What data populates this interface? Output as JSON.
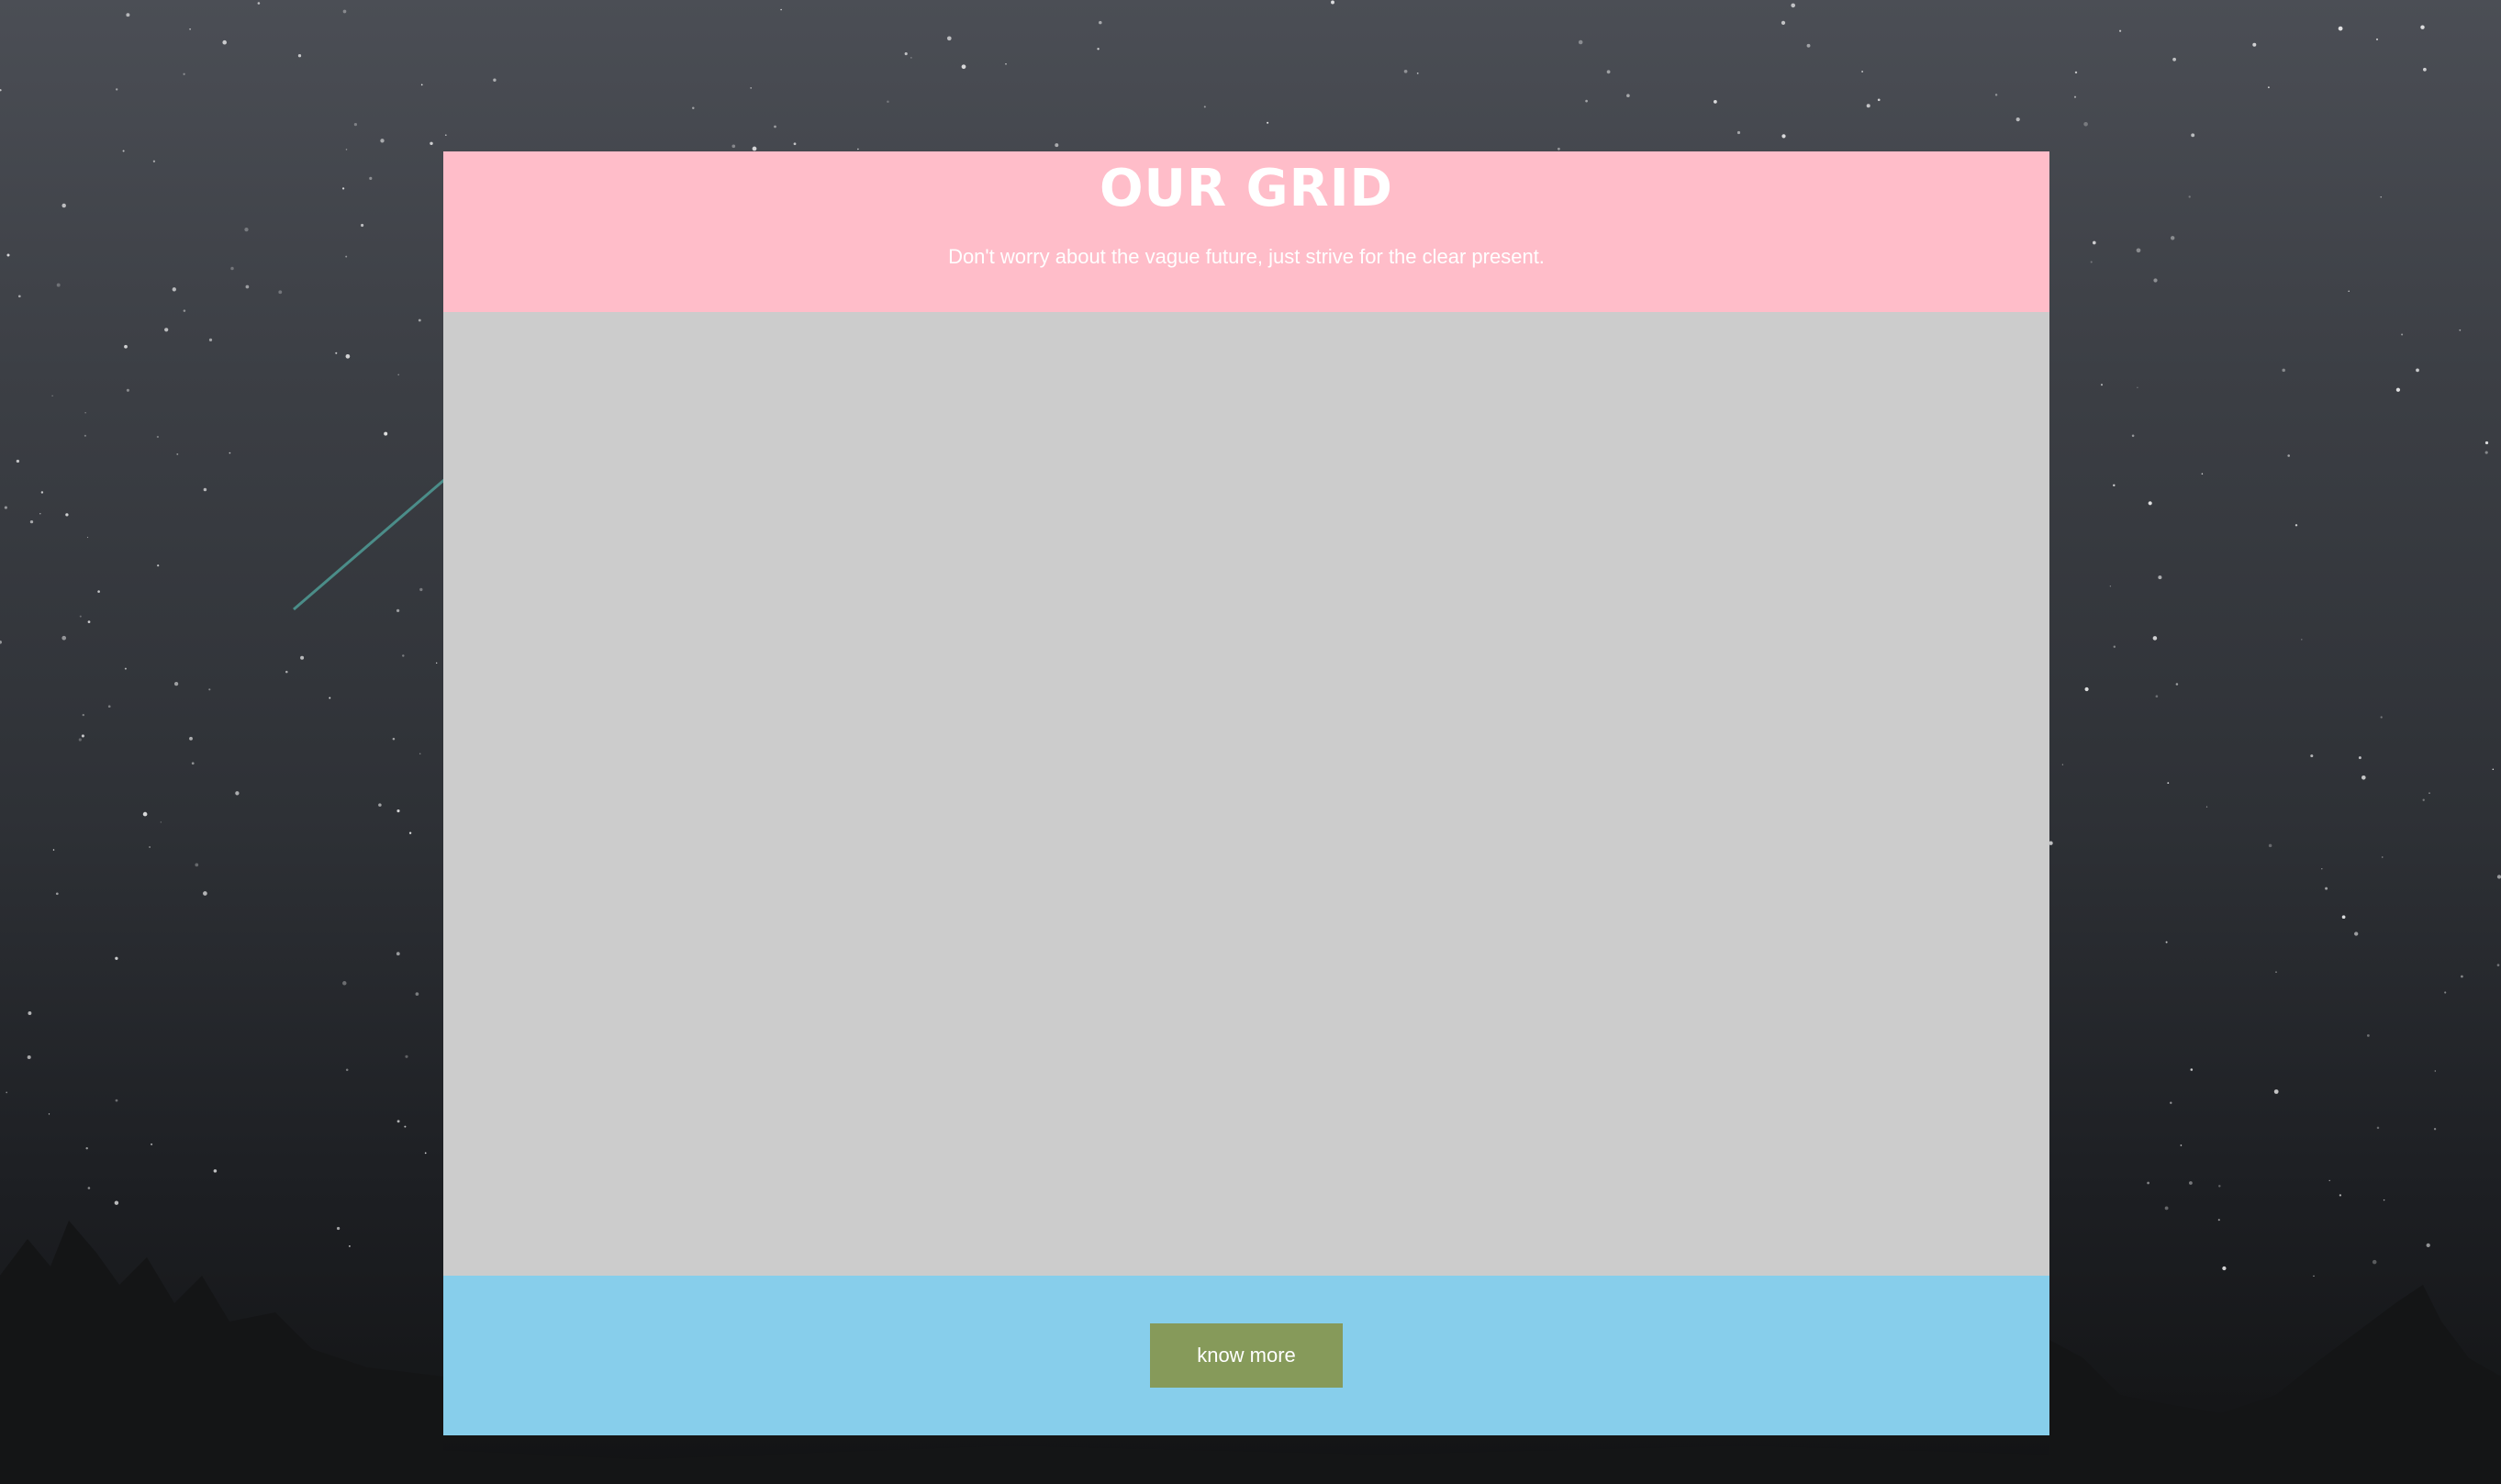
{
  "header": {
    "title": "OUR GRID",
    "subtitle": "Don't worry about the vague future, just strive for the clear present."
  },
  "footer": {
    "button_label": "know more"
  },
  "colors": {
    "header_bg": "#ffbdc9",
    "body_bg": "#cccccc",
    "footer_bg": "#87ceeb",
    "button_bg": "#869a5a",
    "page_bg": "#2e3136"
  }
}
